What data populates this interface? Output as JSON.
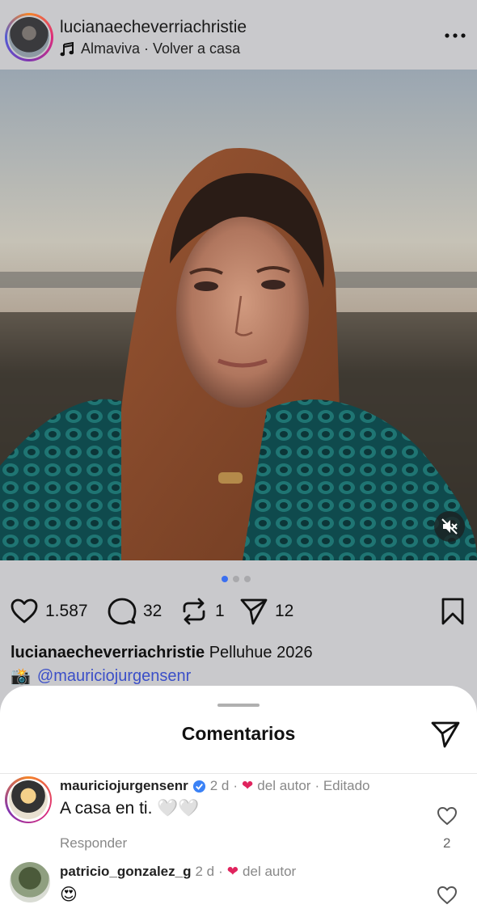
{
  "post": {
    "username": "lucianaecheverriachristie",
    "music": "Almaviva · Volver a casa",
    "icons": {
      "more": "more-horizontal-icon",
      "music": "music-note-icon",
      "mute": "speaker-muted-icon"
    }
  },
  "carousel": {
    "count": 3,
    "active": 0
  },
  "actions": {
    "likes": "1.587",
    "comments": "32",
    "reposts": "1",
    "shares": "12"
  },
  "caption": {
    "username": "lucianaecheverriachristie",
    "text": "Pelluhue 2026",
    "emoji": "📸",
    "mention": "@mauriciojurgensenr"
  },
  "comments_sheet": {
    "title": "Comentarios",
    "comments": [
      {
        "username": "mauriciojurgensenr",
        "verified": true,
        "time": "2 d",
        "sep": "·",
        "author_note": "del autor",
        "edited": "· Editado",
        "text": "A casa en ti. 🤍🤍",
        "reply_label": "Responder",
        "likes": "2"
      },
      {
        "username": "patricio_gonzalez_g",
        "verified": false,
        "time": "2 d",
        "sep": "·",
        "author_note": "del autor",
        "text": "😍"
      }
    ]
  },
  "colors": {
    "background": "#c9c9cc",
    "accent": "#3b6ff0",
    "mention": "#3b4fc8",
    "heart": "#e0245e"
  }
}
